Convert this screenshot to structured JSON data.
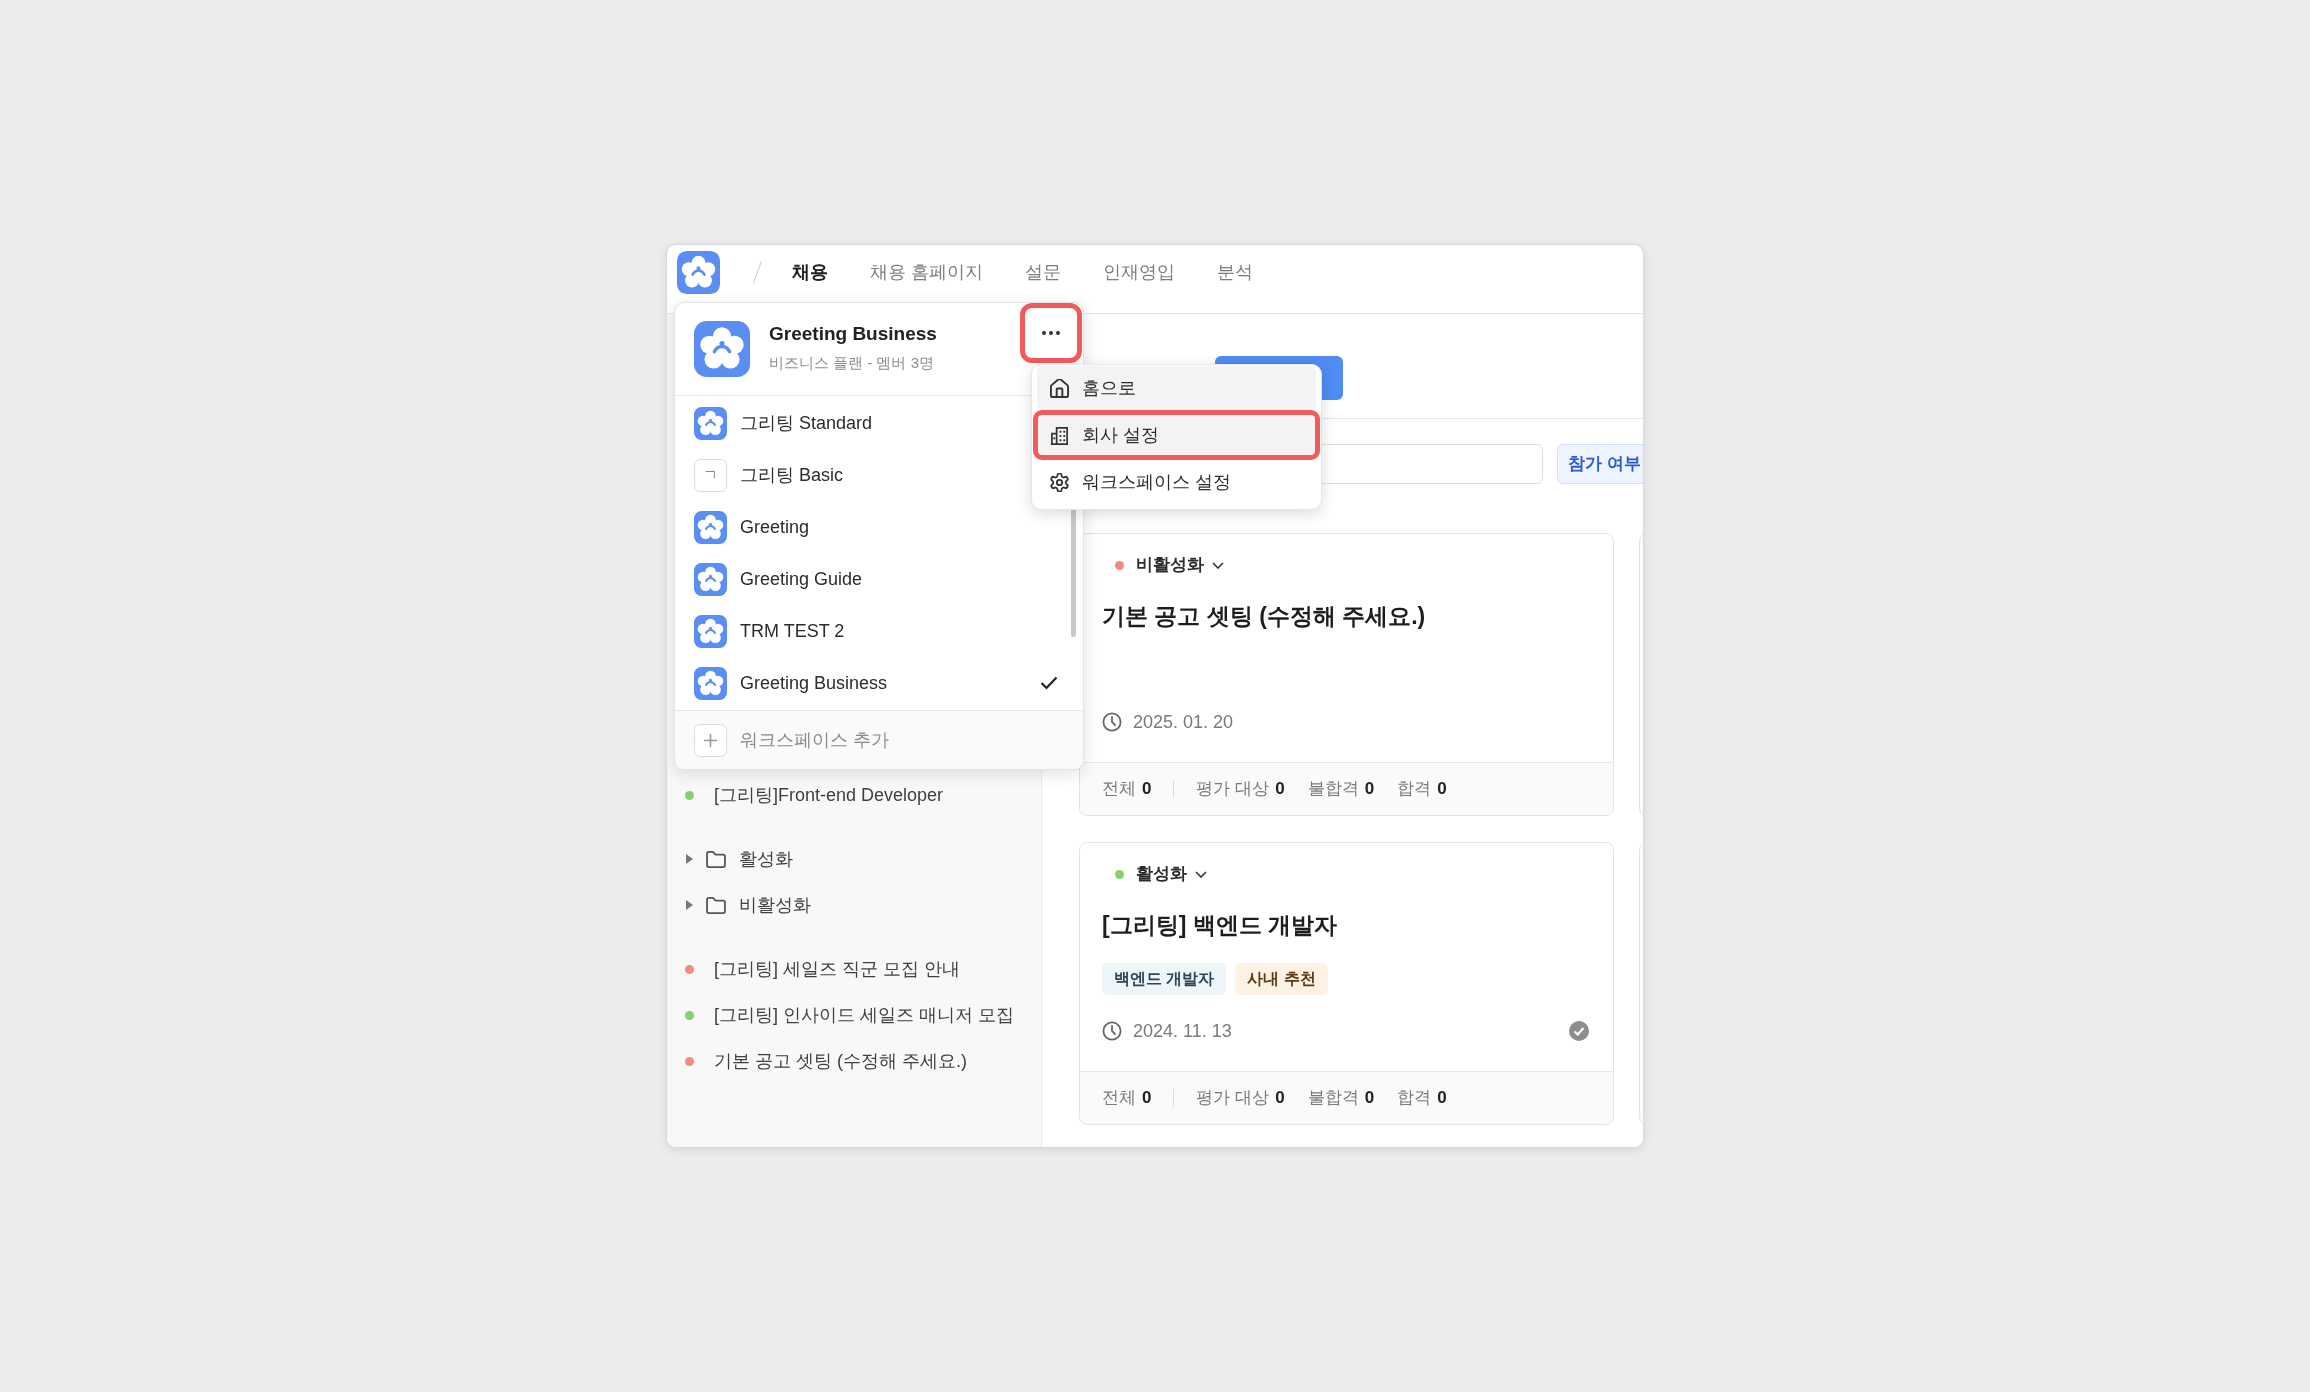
{
  "nav": {
    "tabs": [
      {
        "label": "채용",
        "selected": true
      },
      {
        "label": "채용 홈페이지",
        "selected": false
      },
      {
        "label": "설문",
        "selected": false
      },
      {
        "label": "인재영입",
        "selected": false
      },
      {
        "label": "분석",
        "selected": false
      }
    ]
  },
  "workspace_menu": {
    "current": {
      "name": "Greeting Business",
      "subtitle": "비즈니스 플랜 - 멤버 3명"
    },
    "more_button": {
      "annotated": true
    },
    "workspaces": [
      {
        "kind": "logo",
        "name": "그리팅 Standard",
        "selected": false
      },
      {
        "kind": "initial",
        "initial": "ㄱ",
        "name": "그리팅 Basic",
        "selected": false
      },
      {
        "kind": "logo",
        "name": "Greeting",
        "selected": false
      },
      {
        "kind": "logo",
        "name": "Greeting Guide",
        "selected": false
      },
      {
        "kind": "logo",
        "name": "TRM TEST 2",
        "selected": false
      },
      {
        "kind": "logo",
        "name": "Greeting Business",
        "selected": true
      }
    ],
    "add_item": {
      "label": "워크스페이스 추가"
    }
  },
  "more_menu": {
    "items": [
      {
        "label": "홈으로",
        "highlighted": true,
        "annotated": false
      },
      {
        "label": "회사 설정",
        "highlighted": true,
        "annotated": true
      },
      {
        "label": "워크스페이스 설정",
        "highlighted": false,
        "annotated": false
      }
    ]
  },
  "sidebar": {
    "groups": [
      {
        "items": [
          {
            "kind": "posting",
            "title": "[그리팅]Front-end Developer",
            "color": "#86d06e"
          }
        ]
      },
      {
        "items": [
          {
            "kind": "folder",
            "title": "활성화",
            "expanded": false
          },
          {
            "kind": "folder",
            "title": "비활성화",
            "expanded": false
          }
        ]
      },
      {
        "items": [
          {
            "kind": "posting",
            "title": "[그리팅] 세일즈 직군 모집 안내",
            "color": "#ef8a86"
          },
          {
            "kind": "posting",
            "title": "[그리팅] 인사이드 세일즈 매니저 모집",
            "color": "#86d06e"
          },
          {
            "kind": "posting",
            "title": "기본 공고 셋팅 (수정해 주세요.)",
            "color": "#ef8a86"
          }
        ]
      }
    ]
  },
  "toolbar": {
    "filter_button": {
      "label": "참가 여부"
    }
  },
  "cards": [
    {
      "status": {
        "label": "비활성화",
        "color": "#ef8a86"
      },
      "title": "기본 공고 셋팅 (수정해 주세요.)",
      "date": "2025. 01. 20",
      "verified": false,
      "stats": [
        {
          "label": "전체",
          "value": "0"
        },
        {
          "label": "평가 대상",
          "value": "0"
        },
        {
          "label": "불합격",
          "value": "0"
        },
        {
          "label": "합격",
          "value": "0"
        }
      ]
    },
    {
      "status": {
        "label": "활성화",
        "color": "#86d06e"
      },
      "title": "[그리팅] 백엔드 개발자",
      "tags": [
        {
          "label": "백엔드 개발자",
          "color": "#eef6fa"
        },
        {
          "label": "사내 추천",
          "color": "#fdf2e3"
        }
      ],
      "date": "2024. 11. 13",
      "verified": true,
      "stats": [
        {
          "label": "전체",
          "value": "0"
        },
        {
          "label": "평가 대상",
          "value": "0"
        },
        {
          "label": "불합격",
          "value": "0"
        },
        {
          "label": "합격",
          "value": "0"
        }
      ]
    }
  ]
}
